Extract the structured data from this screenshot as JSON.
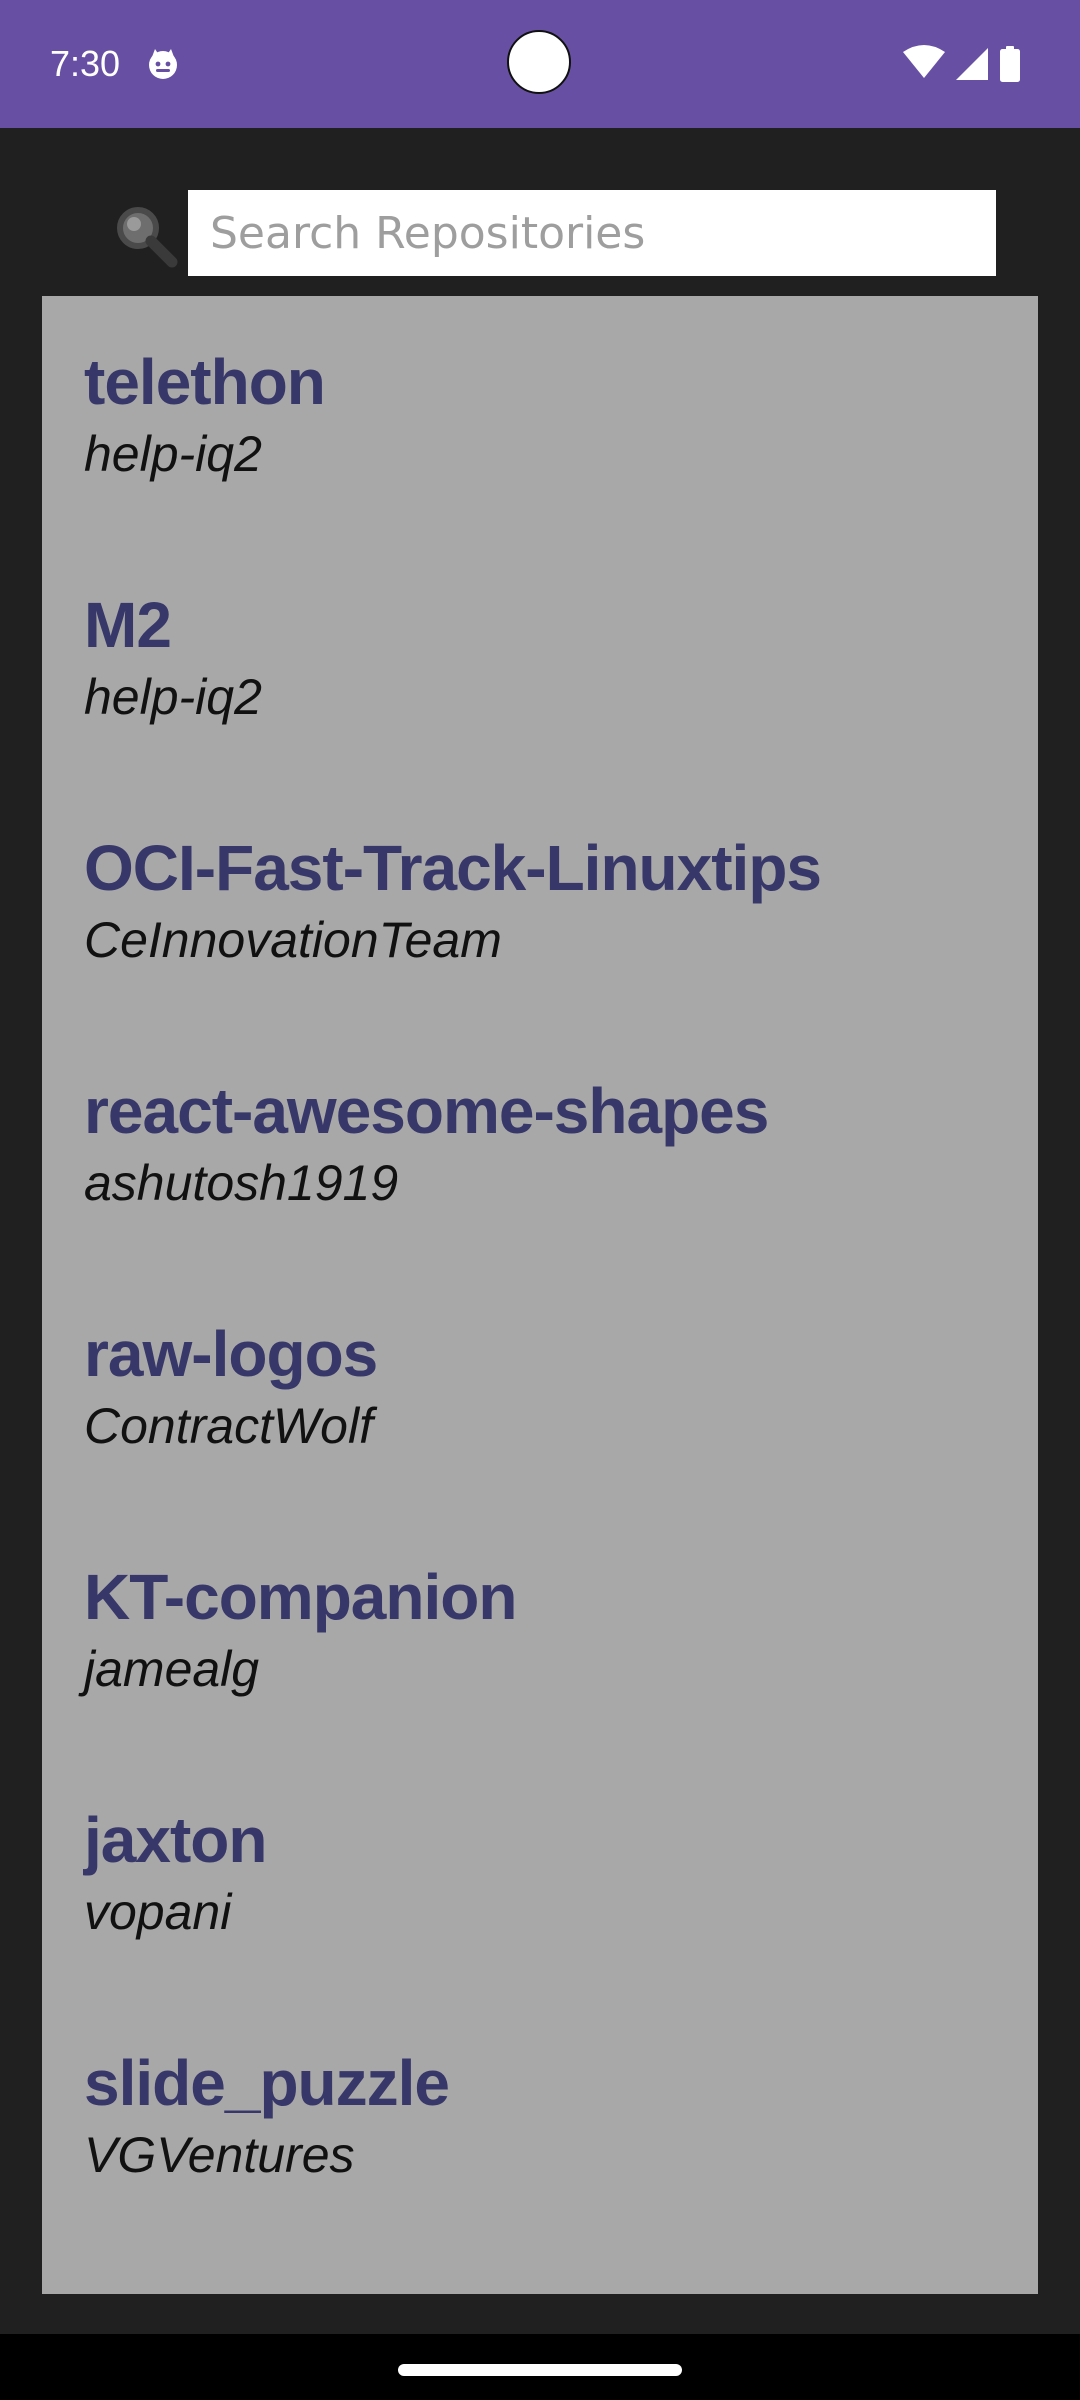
{
  "status_bar": {
    "time": "7:30",
    "app_icon": "android-cat-icon",
    "icons": [
      "wifi-icon",
      "signal-icon",
      "battery-icon"
    ],
    "background_color": "#6750a4"
  },
  "search": {
    "placeholder": "Search Repositories",
    "value": "",
    "icon": "magnifier-icon"
  },
  "repositories": [
    {
      "name": "telethon",
      "owner": "help-iq2"
    },
    {
      "name": "M2",
      "owner": "help-iq2"
    },
    {
      "name": "OCI-Fast-Track-Linuxtips",
      "owner": "CeInnovationTeam"
    },
    {
      "name": "react-awesome-shapes",
      "owner": "ashutosh1919"
    },
    {
      "name": "raw-logos",
      "owner": "ContractWolf"
    },
    {
      "name": "KT-companion",
      "owner": "jamealg"
    },
    {
      "name": "jaxton",
      "owner": "vopani"
    },
    {
      "name": "slide_puzzle",
      "owner": "VGVentures"
    }
  ],
  "colors": {
    "repo_name": "#373769",
    "list_background": "#a8a8a8",
    "app_background": "#202020"
  }
}
